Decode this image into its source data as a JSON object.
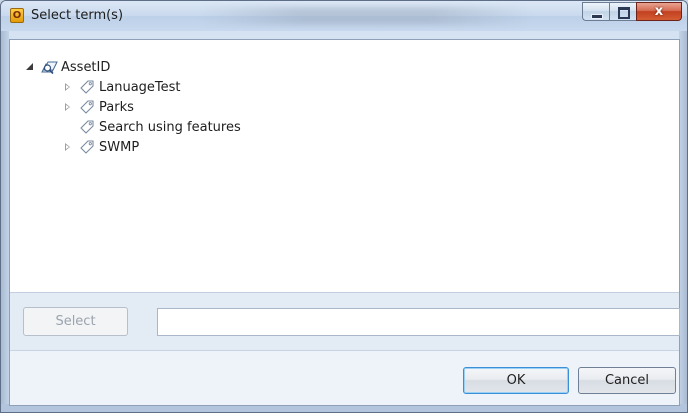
{
  "window": {
    "title": "Select term(s)",
    "app_icon_letter": "O"
  },
  "caption": {
    "close_label": "x"
  },
  "tree": {
    "root": {
      "label": "AssetID",
      "expanded": true,
      "icon": "termstore-icon"
    },
    "children": [
      {
        "label": "LanuageTest",
        "has_children": true,
        "icon": "tag-icon"
      },
      {
        "label": "Parks",
        "has_children": true,
        "icon": "tag-icon"
      },
      {
        "label": "Search using features",
        "has_children": false,
        "icon": "tag-icon"
      },
      {
        "label": "SWMP",
        "has_children": true,
        "icon": "tag-icon"
      }
    ]
  },
  "select_bar": {
    "select_label": "Select",
    "input_value": ""
  },
  "footer": {
    "ok_label": "OK",
    "cancel_label": "Cancel"
  },
  "colors": {
    "accent": "#3a8fd6",
    "close_button": "#c2401f",
    "window_frame": "#c5d6ea"
  }
}
